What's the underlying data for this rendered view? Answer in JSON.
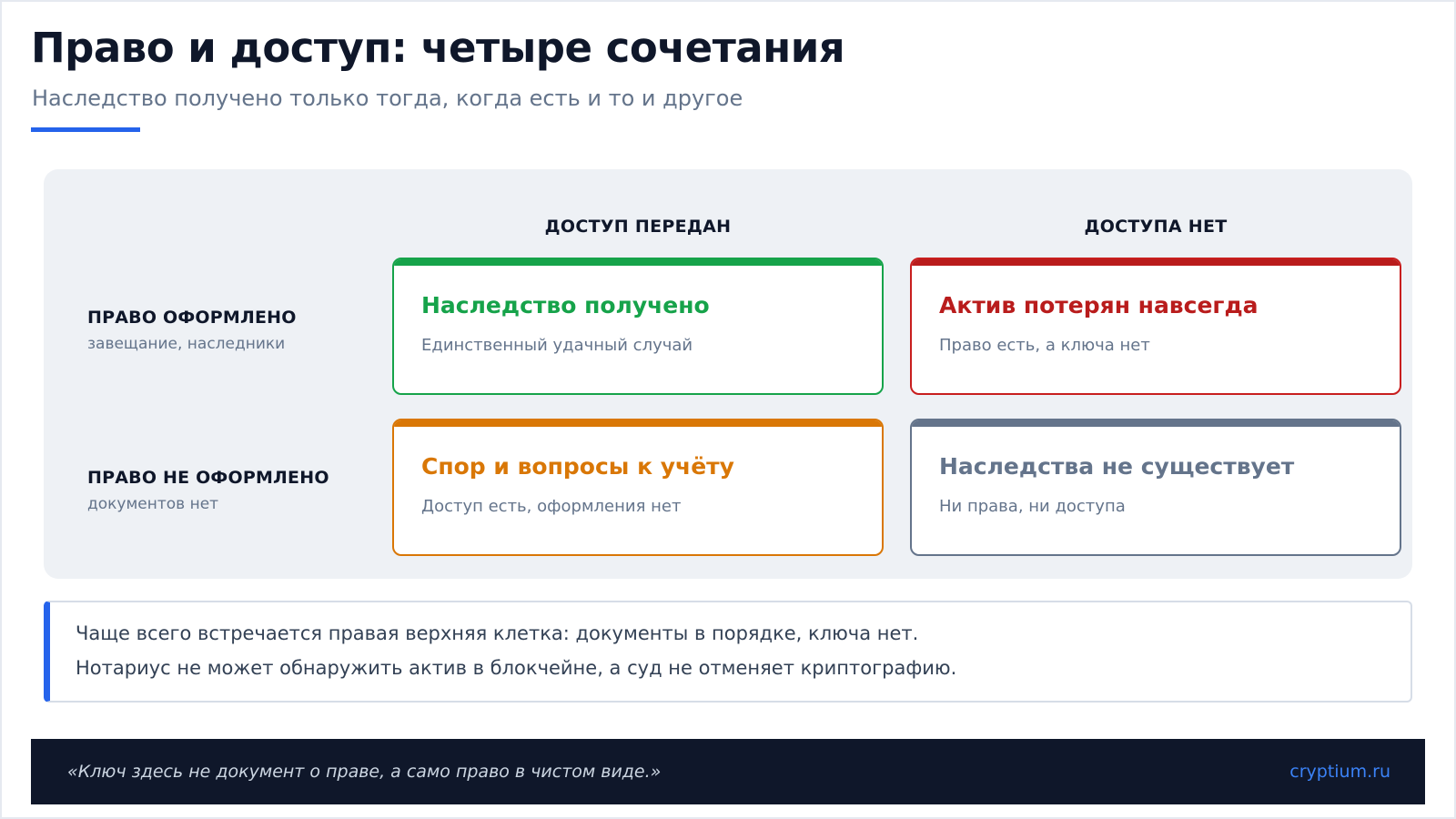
{
  "header": {
    "title": "Право и доступ: четыре сочетания",
    "subtitle": "Наследство получено только тогда, когда есть и то и другое"
  },
  "matrix": {
    "columns": [
      "ДОСТУП ПЕРЕДАН",
      "ДОСТУПА НЕТ"
    ],
    "rows": [
      {
        "title": "ПРАВО ОФОРМЛЕНО",
        "sub": "завещание, наследники"
      },
      {
        "title": "ПРАВО НЕ ОФОРМЛЕНО",
        "sub": "документов нет"
      }
    ],
    "cells": [
      {
        "title": "Наследство получено",
        "sub": "Единственный удачный случай",
        "color": "#16a34a"
      },
      {
        "title": "Актив потерян навсегда",
        "sub": "Право есть, а ключа нет",
        "color": "#b91c1c"
      },
      {
        "title": "Спор и вопросы к учёту",
        "sub": "Доступ есть, оформления нет",
        "color": "#d97706"
      },
      {
        "title": "Наследства не существует",
        "sub": "Ни права, ни доступа",
        "color": "#64748b"
      }
    ]
  },
  "note": {
    "line1": "Чаще всего встречается правая верхняя клетка: документы в порядке, ключа нет.",
    "line2": "Нотариус не может обнаружить актив в блокчейне, а суд не отменяет криптографию."
  },
  "footer": {
    "quote": "«Ключ здесь не документ о праве, а само право в чистом виде.»",
    "brand": "cryptium.ru"
  },
  "colors": {
    "accent": "#2563eb",
    "success": "#16a34a",
    "danger": "#b91c1c",
    "warning": "#d97706",
    "neutral": "#64748b",
    "footer_bg": "#0f172a"
  }
}
